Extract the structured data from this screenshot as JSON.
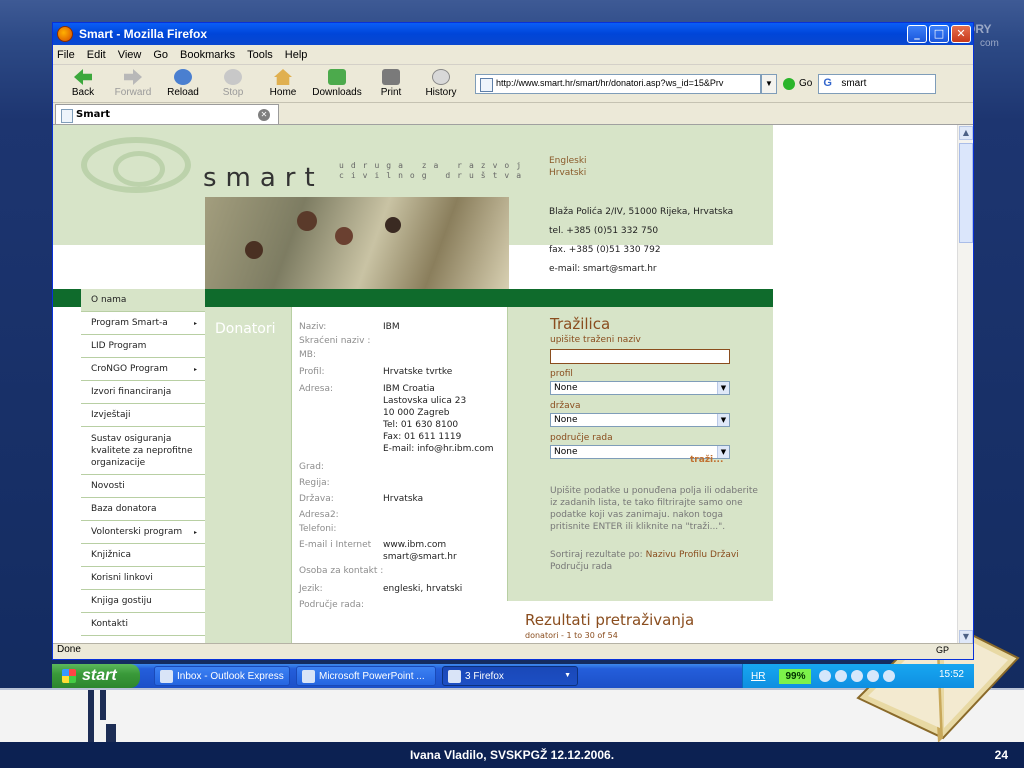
{
  "slide": {
    "footer": "Ivana Vladilo, SVSKPGŽ 12.12.2006.",
    "page_number": "24",
    "corner_text_1": "ORY",
    "corner_text_2": "com"
  },
  "window": {
    "title": "Smart - Mozilla Firefox",
    "controls": {
      "minimize": "_",
      "maximize": "□",
      "close": "✕"
    }
  },
  "menu": [
    "File",
    "Edit",
    "View",
    "Go",
    "Bookmarks",
    "Tools",
    "Help"
  ],
  "toolbar": {
    "back": "Back",
    "forward": "Forward",
    "reload": "Reload",
    "stop": "Stop",
    "home": "Home",
    "downloads": "Downloads",
    "print": "Print",
    "history": "History",
    "url": "http://www.smart.hr/smart/hr/donatori.asp?ws_id=15&Prv",
    "go": "Go",
    "search": "smart"
  },
  "tab": {
    "label": "Smart"
  },
  "status": {
    "text": "Done",
    "gp": "GP"
  },
  "page": {
    "logo_text": "smart",
    "logo_sub_1": "udruga za razvoj",
    "logo_sub_2": "civilnog društva",
    "languages": [
      "Engleski",
      "Hrvatski"
    ],
    "contact": [
      "Blaža Polića 2/IV, 51000 Rijeka, Hrvatska",
      "tel. +385 (0)51 332 750",
      "fax. +385 (0)51 330 792",
      "e-mail: smart@smart.hr"
    ],
    "sidebar": [
      {
        "label": "O nama",
        "arrow": ""
      },
      {
        "label": "Program Smart-a",
        "arrow": "▸"
      },
      {
        "label": "LID Program",
        "arrow": ""
      },
      {
        "label": "CroNGO Program",
        "arrow": "▸"
      },
      {
        "label": "Izvori financiranja",
        "arrow": ""
      },
      {
        "label": "Izvještaji",
        "arrow": ""
      },
      {
        "label": "Sustav osiguranja kvalitete za neprofitne organizacije",
        "arrow": ""
      },
      {
        "label": "Novosti",
        "arrow": ""
      },
      {
        "label": "Baza donatora",
        "arrow": ""
      },
      {
        "label": "Volonterski program",
        "arrow": "▸"
      },
      {
        "label": "Knjižnica",
        "arrow": ""
      },
      {
        "label": "Korisni linkovi",
        "arrow": ""
      },
      {
        "label": "Knjiga gostiju",
        "arrow": ""
      },
      {
        "label": "Kontakti",
        "arrow": ""
      }
    ],
    "section_title": "Donatori",
    "fields": [
      {
        "label": "Naziv:",
        "value": "IBM"
      },
      {
        "label": "Skraćeni naziv :",
        "value": ""
      },
      {
        "label": "MB:",
        "value": ""
      },
      {
        "label": "Profil:",
        "value": "Hrvatske tvrtke"
      },
      {
        "label": "Adresa:",
        "value": "IBM Croatia"
      },
      {
        "label": "",
        "value": "Lastovska ulica 23"
      },
      {
        "label": "",
        "value": "10 000 Zagreb"
      },
      {
        "label": "",
        "value": "Tel: 01 630 8100"
      },
      {
        "label": "",
        "value": "Fax: 01 611 1119"
      },
      {
        "label": "",
        "value": "E-mail: info@hr.ibm.com"
      },
      {
        "label": "Grad:",
        "value": ""
      },
      {
        "label": "Regija:",
        "value": ""
      },
      {
        "label": "Država:",
        "value": "Hrvatska"
      },
      {
        "label": "Adresa2:",
        "value": ""
      },
      {
        "label": "Telefoni:",
        "value": ""
      },
      {
        "label": "E-mail i Internet",
        "value": "www.ibm.com"
      },
      {
        "label": "",
        "value": "smart@smart.hr"
      },
      {
        "label": "Osoba za kontakt :",
        "value": ""
      },
      {
        "label": "Jezik:",
        "value": "engleski, hrvatski"
      },
      {
        "label": "Područje rada:",
        "value": ""
      }
    ],
    "search": {
      "title": "Tražilica",
      "name_label": "upišite traženi naziv",
      "name_value": "",
      "profil_label": "profil",
      "profil_value": "None",
      "drzava_label": "država",
      "drzava_value": "None",
      "podrucje_label": "područje rada",
      "podrucje_value": "None",
      "submit": "traži...",
      "help": "Upišite podatke u ponuđena polja ili odaberite iz zadanih lista, te tako filtrirajte samo one podatke koji vas zanimaju. nakon toga pritisnite ENTER ili kliknite na \"traži...\".",
      "sort_label": "Sortiraj rezultate po:",
      "sort_options": "Nazivu Profilu Državi",
      "sort_options_2": "Području rada"
    },
    "results": {
      "title": "Rezultati pretraživanja",
      "subtitle": "donatori - 1 to 30 of 54"
    }
  },
  "taskbar": {
    "start": "start",
    "items": [
      "Inbox - Outlook Express",
      "Microsoft PowerPoint ...",
      "3 Firefox"
    ],
    "lang": "HR",
    "battery": "99%",
    "clock": "15:52"
  }
}
